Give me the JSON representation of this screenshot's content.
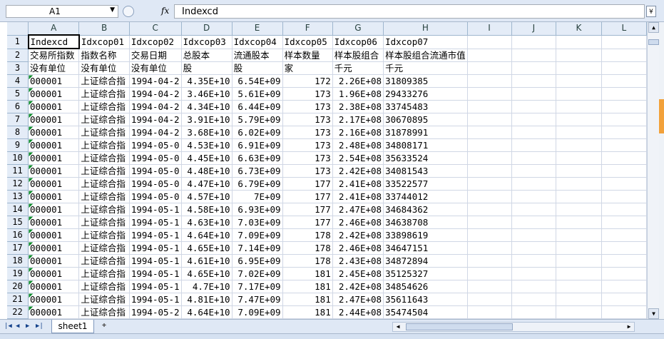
{
  "formula_bar": {
    "name_box": "A1",
    "fx_label": "fx",
    "formula": "Indexcd"
  },
  "columns": [
    "A",
    "B",
    "C",
    "D",
    "E",
    "F",
    "G",
    "H",
    "I",
    "J",
    "K",
    "L"
  ],
  "rows": [
    [
      "Indexcd",
      "Idxcop01",
      "Idxcop02",
      "Idxcop03",
      "Idxcop04",
      "Idxcop05",
      "Idxcop06",
      "Idxcop07",
      "",
      "",
      "",
      ""
    ],
    [
      "交易所指数",
      "指数名称",
      "交易日期",
      "总股本",
      "流通股本",
      "样本数量",
      "样本股组合",
      "样本股组合流通市值",
      "",
      "",
      "",
      ""
    ],
    [
      "没有单位",
      "没有单位",
      "没有单位",
      "股",
      "股",
      "家",
      "千元",
      "千元",
      "",
      "",
      "",
      ""
    ],
    [
      "000001",
      "上证综合指",
      "1994-04-2",
      "4.35E+10",
      "6.54E+09",
      "172",
      "2.26E+08",
      "31809385",
      "",
      "",
      "",
      ""
    ],
    [
      "000001",
      "上证综合指",
      "1994-04-2",
      "3.46E+10",
      "5.61E+09",
      "173",
      "1.96E+08",
      "29433276",
      "",
      "",
      "",
      ""
    ],
    [
      "000001",
      "上证综合指",
      "1994-04-2",
      "4.34E+10",
      "6.44E+09",
      "173",
      "2.38E+08",
      "33745483",
      "",
      "",
      "",
      ""
    ],
    [
      "000001",
      "上证综合指",
      "1994-04-2",
      "3.91E+10",
      "5.79E+09",
      "173",
      "2.17E+08",
      "30670895",
      "",
      "",
      "",
      ""
    ],
    [
      "000001",
      "上证综合指",
      "1994-04-2",
      "3.68E+10",
      "6.02E+09",
      "173",
      "2.16E+08",
      "31878991",
      "",
      "",
      "",
      ""
    ],
    [
      "000001",
      "上证综合指",
      "1994-05-0",
      "4.53E+10",
      "6.91E+09",
      "173",
      "2.48E+08",
      "34808171",
      "",
      "",
      "",
      ""
    ],
    [
      "000001",
      "上证综合指",
      "1994-05-0",
      "4.45E+10",
      "6.63E+09",
      "173",
      "2.54E+08",
      "35633524",
      "",
      "",
      "",
      ""
    ],
    [
      "000001",
      "上证综合指",
      "1994-05-0",
      "4.48E+10",
      "6.73E+09",
      "173",
      "2.42E+08",
      "34081543",
      "",
      "",
      "",
      ""
    ],
    [
      "000001",
      "上证综合指",
      "1994-05-0",
      "4.47E+10",
      "6.79E+09",
      "177",
      "2.41E+08",
      "33522577",
      "",
      "",
      "",
      ""
    ],
    [
      "000001",
      "上证综合指",
      "1994-05-0",
      "4.57E+10",
      "7E+09",
      "177",
      "2.41E+08",
      "33744012",
      "",
      "",
      "",
      ""
    ],
    [
      "000001",
      "上证综合指",
      "1994-05-1",
      "4.58E+10",
      "6.93E+09",
      "177",
      "2.47E+08",
      "34684362",
      "",
      "",
      "",
      ""
    ],
    [
      "000001",
      "上证综合指",
      "1994-05-1",
      "4.63E+10",
      "7.03E+09",
      "177",
      "2.46E+08",
      "34638708",
      "",
      "",
      "",
      ""
    ],
    [
      "000001",
      "上证综合指",
      "1994-05-1",
      "4.64E+10",
      "7.09E+09",
      "178",
      "2.42E+08",
      "33898619",
      "",
      "",
      "",
      ""
    ],
    [
      "000001",
      "上证综合指",
      "1994-05-1",
      "4.65E+10",
      "7.14E+09",
      "178",
      "2.46E+08",
      "34647151",
      "",
      "",
      "",
      ""
    ],
    [
      "000001",
      "上证综合指",
      "1994-05-1",
      "4.61E+10",
      "6.95E+09",
      "178",
      "2.43E+08",
      "34872894",
      "",
      "",
      "",
      ""
    ],
    [
      "000001",
      "上证综合指",
      "1994-05-1",
      "4.65E+10",
      "7.02E+09",
      "181",
      "2.45E+08",
      "35125327",
      "",
      "",
      "",
      ""
    ],
    [
      "000001",
      "上证综合指",
      "1994-05-1",
      "4.7E+10",
      "7.17E+09",
      "181",
      "2.42E+08",
      "34854626",
      "",
      "",
      "",
      ""
    ],
    [
      "000001",
      "上证综合指",
      "1994-05-1",
      "4.81E+10",
      "7.47E+09",
      "181",
      "2.47E+08",
      "35611643",
      "",
      "",
      "",
      ""
    ],
    [
      "000001",
      "上证综合指",
      "1994-05-2",
      "4.64E+10",
      "7.09E+09",
      "181",
      "2.44E+08",
      "35474504",
      "",
      "",
      "",
      ""
    ]
  ],
  "sheet_tabs": [
    "sheet1"
  ],
  "selected_cell": "A1"
}
